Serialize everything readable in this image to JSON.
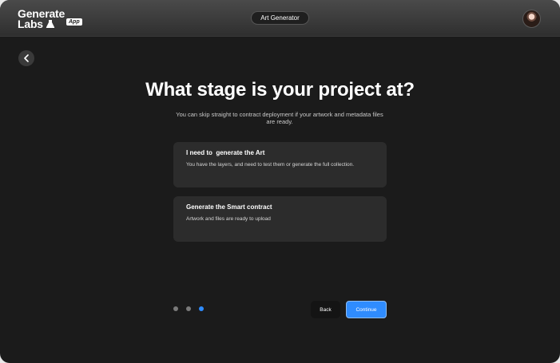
{
  "header": {
    "logo_line1": "Generate",
    "logo_line2": "Labs",
    "logo_badge": "App",
    "center_pill": "Art Generator"
  },
  "page": {
    "title": "What stage is your project at?",
    "subtitle": "You can skip straight to contract deployment if your artwork and metadata files are ready."
  },
  "options": [
    {
      "title": "I need to  generate the Art",
      "description": "You have the layers, and need to test them or generate the full collection."
    },
    {
      "title": "Generate the Smart contract",
      "description": "Artwork and files are ready to upload"
    }
  ],
  "steps": {
    "total": 3,
    "current": 3
  },
  "footer": {
    "back_label": "Back",
    "continue_label": "Continue"
  },
  "colors": {
    "accent": "#2f8cff",
    "background": "#1b1b1b",
    "card": "#2c2c2c"
  },
  "icons": {
    "back": "chevron-left-icon",
    "logo": "flask-icon",
    "user": "avatar"
  }
}
